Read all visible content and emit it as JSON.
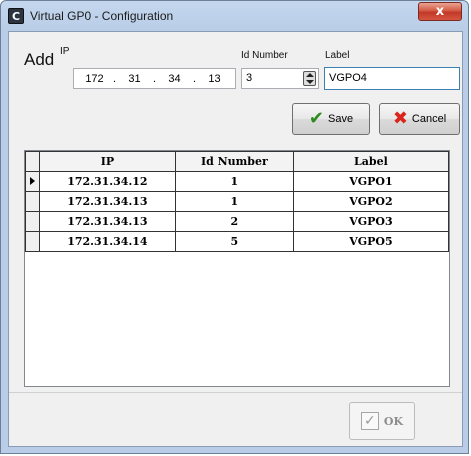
{
  "window": {
    "icon_letter": "C",
    "title": "Virtual GP0 - Configuration",
    "close_glyph": "x"
  },
  "form": {
    "add_label": "Add",
    "ip_label": "IP",
    "ip_octets": [
      "172",
      "31",
      "34",
      "13"
    ],
    "ip_separator": ".",
    "id_label": "Id Number",
    "id_value": "3",
    "label_label": "Label",
    "label_value": "VGPO4"
  },
  "buttons": {
    "save_label": "Save",
    "cancel_label": "Cancel",
    "ok_label": "OK"
  },
  "table": {
    "columns": [
      "IP",
      "Id Number",
      "Label"
    ],
    "rows": [
      {
        "ip": "172.31.34.12",
        "id": "1",
        "label": "VGPO1"
      },
      {
        "ip": "172.31.34.13",
        "id": "1",
        "label": "VGPO2"
      },
      {
        "ip": "172.31.34.13",
        "id": "2",
        "label": "VGPO3"
      },
      {
        "ip": "172.31.34.14",
        "id": "5",
        "label": "VGPO5"
      }
    ],
    "current_row_index": 0
  },
  "colors": {
    "title_bar": "#b9cde8",
    "close_button": "#c2382a",
    "save_icon": "#2e8b1f",
    "cancel_icon": "#d8261d"
  },
  "icons": {
    "save": "checkmark-icon",
    "cancel": "red-x-icon",
    "ok": "checkbox-icon"
  }
}
